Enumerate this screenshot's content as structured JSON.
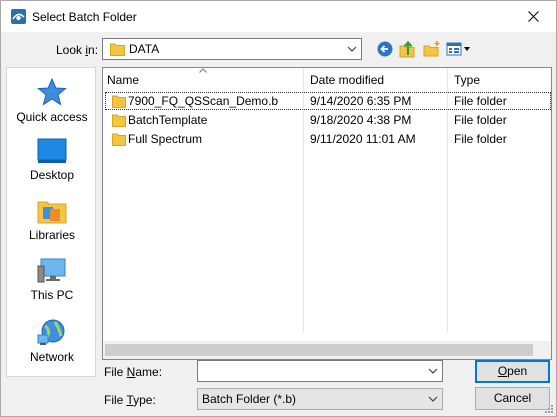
{
  "window": {
    "title": "Select Batch Folder",
    "title_icon": "batch-app-icon",
    "close_icon": "close-icon"
  },
  "lookin": {
    "label_prefix": "Look ",
    "label_accel": "i",
    "label_suffix": "n:",
    "value": "DATA"
  },
  "toolbar": {
    "back_icon": "back-arrow-icon",
    "up_icon": "up-folder-icon",
    "new_folder_icon": "new-folder-icon",
    "view_icon": "view-menu-icon"
  },
  "places": [
    {
      "label": "Quick access",
      "icon": "star-icon"
    },
    {
      "label": "Desktop",
      "icon": "desktop-icon"
    },
    {
      "label": "Libraries",
      "icon": "libraries-icon"
    },
    {
      "label": "This PC",
      "icon": "this-pc-icon"
    },
    {
      "label": "Network",
      "icon": "network-icon"
    }
  ],
  "columns": [
    "Name",
    "Date modified",
    "Type"
  ],
  "files": [
    {
      "name": "7900_FQ_QSScan_Demo.b",
      "date": "9/14/2020 6:35 PM",
      "type": "File folder"
    },
    {
      "name": "BatchTemplate",
      "date": "9/18/2020 4:38 PM",
      "type": "File folder"
    },
    {
      "name": "Full Spectrum",
      "date": "9/11/2020 11:01 AM",
      "type": "File folder"
    }
  ],
  "filename": {
    "label_prefix": "File ",
    "label_accel": "N",
    "label_suffix": "ame:",
    "value": ""
  },
  "filetype": {
    "label_prefix": "File ",
    "label_accel": "T",
    "label_suffix": "ype:",
    "value": "Batch Folder (*.b)"
  },
  "buttons": {
    "open_accel": "O",
    "open_rest": "pen",
    "cancel": "Cancel"
  },
  "colors": {
    "folder": "#f4c542",
    "accent": "#0078d7"
  }
}
